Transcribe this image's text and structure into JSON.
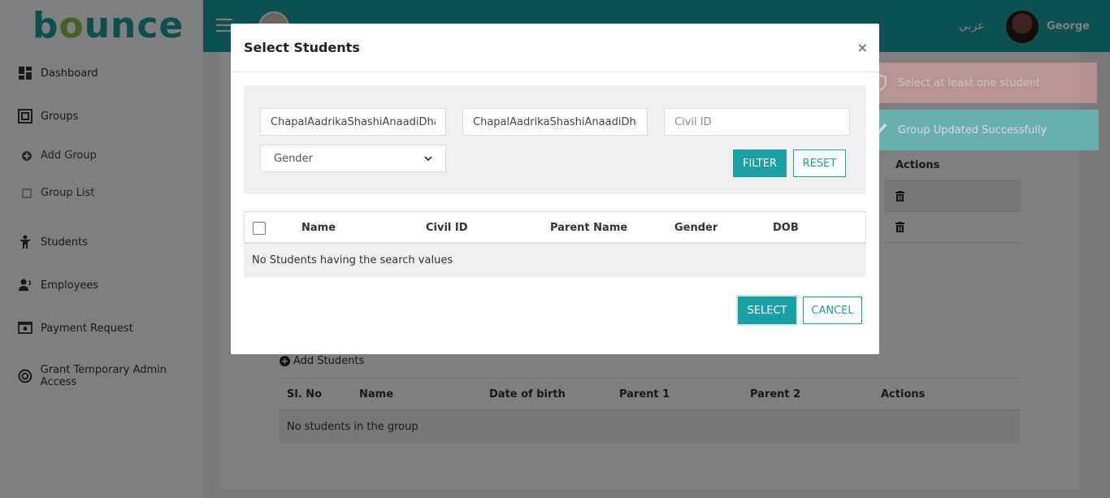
{
  "brand": {
    "logo_text": "bounce",
    "accent": "#1aa0a4"
  },
  "sidebar": {
    "items": [
      {
        "label": "Dashboard",
        "icon": "dashboard-icon"
      },
      {
        "label": "Groups",
        "icon": "groups-icon"
      },
      {
        "label": "Add Group",
        "icon": "plus-circle-icon"
      },
      {
        "label": "Group List",
        "icon": "square-icon"
      },
      {
        "label": "Students",
        "icon": "student-icon"
      },
      {
        "label": "Employees",
        "icon": "employees-icon"
      },
      {
        "label": "Payment Request",
        "icon": "payment-icon"
      },
      {
        "label": "Grant Temporary Admin Access",
        "icon": "lifebuoy-icon"
      }
    ]
  },
  "header": {
    "language": "عربي",
    "user_name": "George"
  },
  "background": {
    "actions_header": "Actions",
    "add_students_label": "Add Students",
    "group_table": {
      "columns": [
        "Sl. No",
        "Name",
        "Date of birth",
        "Parent 1",
        "Parent 2",
        "Actions"
      ],
      "empty_text": "No students in the group"
    }
  },
  "toasts": {
    "error": "Select at least one student",
    "success": "Group Updated Successfully"
  },
  "modal": {
    "title": "Select Students",
    "close_symbol": "×",
    "filters": {
      "name_value": "ChapalAadrikaShashiAnaadiDhana",
      "parent_value": "ChapalAadrikaShashiAnaadiDhana",
      "civil_id_placeholder": "Civil ID",
      "gender_selected": "Gender"
    },
    "filter_label": "FILTER",
    "reset_label": "RESET",
    "table": {
      "columns": [
        "Name",
        "Civil ID",
        "Parent Name",
        "Gender",
        "DOB"
      ],
      "empty_text": "No Students having the search values"
    },
    "select_label": "SELECT",
    "cancel_label": "CANCEL"
  }
}
